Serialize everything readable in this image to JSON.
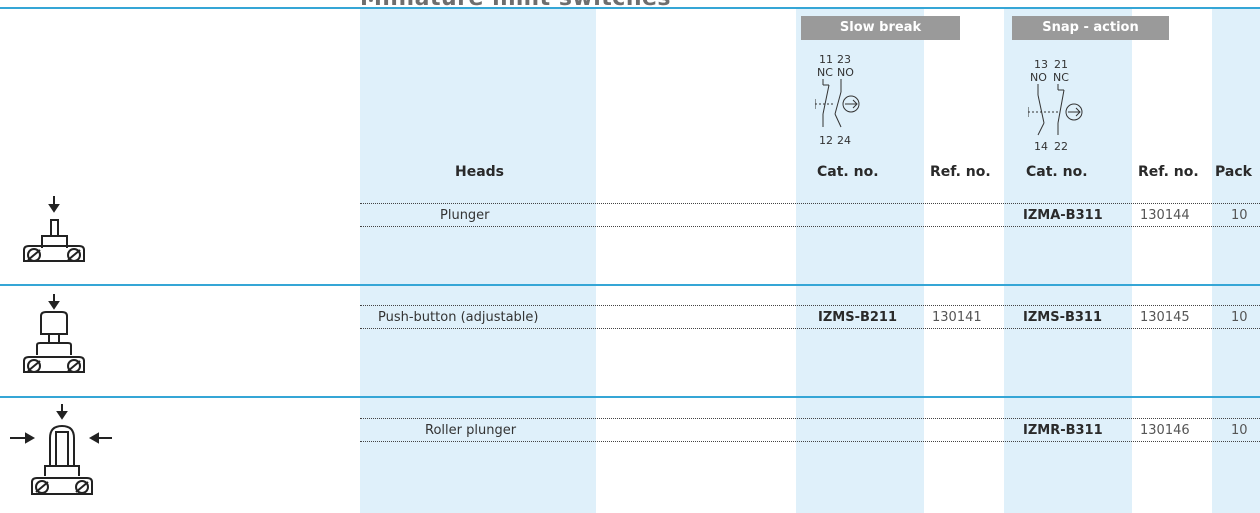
{
  "page_title": "Miniature limit switches",
  "groups": {
    "slow_break": "Slow break",
    "snap_action": "Snap - action"
  },
  "diagrams": {
    "slow_break": {
      "top_left": "11",
      "top_right": "23",
      "left_type": "NC",
      "right_type": "NO",
      "bottom_left": "12",
      "bottom_right": "24"
    },
    "snap_action": {
      "top_left": "13",
      "top_right": "21",
      "left_type": "NO",
      "right_type": "NC",
      "bottom_left": "14",
      "bottom_right": "22"
    }
  },
  "columns": {
    "heads": "Heads",
    "slow_cat": "Cat. no.",
    "slow_ref": "Ref. no.",
    "snap_cat": "Cat. no.",
    "snap_ref": "Ref. no.",
    "pack": "Pack"
  },
  "rows": [
    {
      "icon": "plunger-head-icon",
      "head": "Plunger",
      "slow_cat": "",
      "slow_ref": "",
      "snap_cat": "IZMA-B311",
      "snap_ref": "130144",
      "pack": "10"
    },
    {
      "icon": "push-button-head-icon",
      "head": "Push-button (adjustable)",
      "slow_cat": "IZMS-B211",
      "slow_ref": "130141",
      "snap_cat": "IZMS-B311",
      "snap_ref": "130145",
      "pack": "10"
    },
    {
      "icon": "roller-plunger-head-icon",
      "head": "Roller plunger",
      "slow_cat": "",
      "slow_ref": "",
      "snap_cat": "IZMR-B311",
      "snap_ref": "130146",
      "pack": "10"
    }
  ],
  "colors": {
    "accent_blue": "#35a6d6",
    "band_blue": "#dff0fa",
    "header_grey": "#9a9a9a"
  }
}
